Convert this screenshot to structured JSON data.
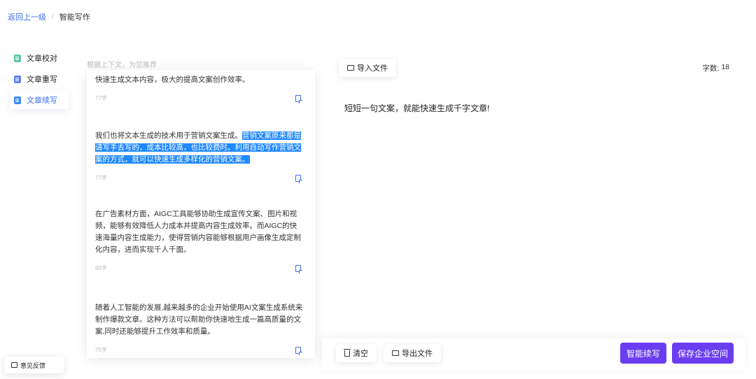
{
  "breadcrumb": {
    "back": "返回上一级",
    "separator": "/",
    "current": "智能写作"
  },
  "sidebar": {
    "items": [
      {
        "label": "文章校对",
        "icon_color": "#5cc8a0"
      },
      {
        "label": "文章重写",
        "icon_color": "#5f7ef0"
      },
      {
        "label": "文章续写",
        "icon_color": "#3a8cf0"
      }
    ]
  },
  "feedback": {
    "label": "意见反馈"
  },
  "recommend": {
    "hint": "根据上下文，为您推荐",
    "cards": [
      {
        "text": "快速生成文本内容，极大的提高文案创作效率。",
        "count": "77字"
      },
      {
        "text_plain": "我们也将文本生成的技术用于营销文案生成。",
        "text_highlight": "营销文案原来都是请写手去写的，成本比较高，也比较费时。利用自动写作营销文案的方式，就可以快速生成多样化的营销文案。",
        "count": "77字"
      },
      {
        "text": "在广告素材方面，AIGC工具能够协助生成宣传文案、图片和视频，能够有效降低人力成本并提高内容生成效率。而AIGC的快速海量内容生成能力，使得营销内容能够根据用户画像生成定制化内容，进而实现千人千面。",
        "count": "99字"
      },
      {
        "text": "随着人工智能的发展,越来越多的企业开始使用AI文案生成系统来制作爆款文章。这种方法可以帮助你快速地生成一篇高质量的文案,同时还能够提升工作效率和质量。",
        "count": "75字"
      }
    ]
  },
  "editor": {
    "import_label": "导入文件",
    "word_count_label": "字数:",
    "word_count": "18",
    "content": "短短一句文案，就能快速生成千字文章!"
  },
  "actions": {
    "clear": "清空",
    "export": "导出文件",
    "continue": "智能续写",
    "save": "保存企业空间"
  },
  "colors": {
    "accent": "#3a6df0",
    "primary": "#6a3df0",
    "highlight": "#1e88ff"
  }
}
